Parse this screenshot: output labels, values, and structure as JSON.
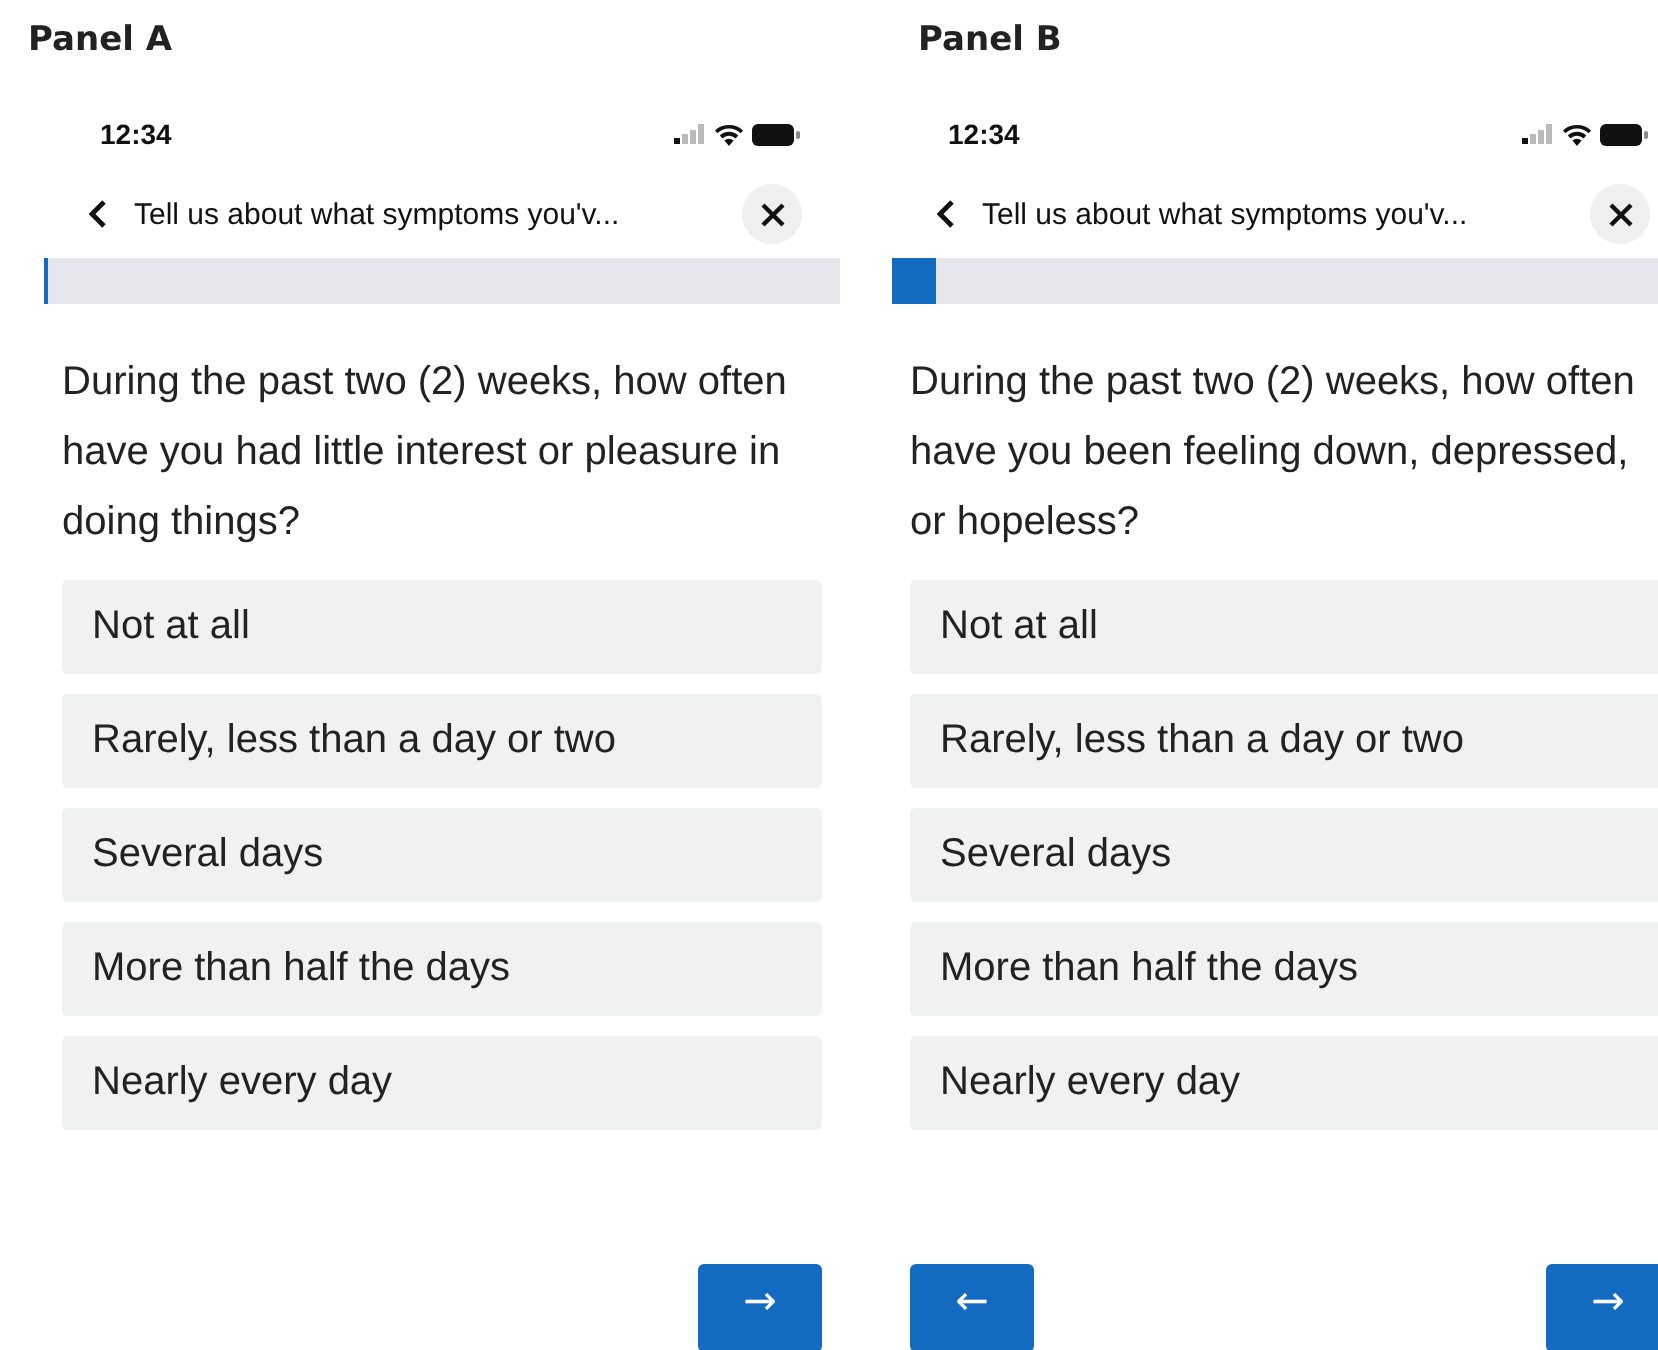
{
  "panels": [
    {
      "label": "Panel A",
      "status_bar": {
        "time": "12:34"
      },
      "header": {
        "title": "Tell us about what symptoms you'v..."
      },
      "progress": {
        "level": 0.005
      },
      "question": "During the past two (2) weeks, how often have you had little interest or pleasure in doing things?",
      "options": [
        {
          "label": "Not at all",
          "selected": false
        },
        {
          "label": "Rarely, less than a day or two",
          "selected": false
        },
        {
          "label": "Several days",
          "selected": false
        },
        {
          "label": "More than half the days",
          "selected": false
        },
        {
          "label": "Nearly every day",
          "selected": false
        }
      ],
      "buttons": [
        {
          "kind": "next",
          "label": "→"
        }
      ]
    },
    {
      "label": "Panel B",
      "status_bar": {
        "time": "12:34"
      },
      "header": {
        "title": "Tell us about what symptoms you'v..."
      },
      "progress": {
        "level": 0.055
      },
      "question": "During the past two (2) weeks, how often have you been feeling down, depressed, or hopeless?",
      "options": [
        {
          "label": "Not at all",
          "selected": false
        },
        {
          "label": "Rarely, less than a day or two",
          "selected": false
        },
        {
          "label": "Several days",
          "selected": false
        },
        {
          "label": "More than half the days",
          "selected": false
        },
        {
          "label": "Nearly every day",
          "selected": false
        }
      ],
      "buttons": [
        {
          "kind": "back",
          "label": "←"
        },
        {
          "kind": "next",
          "label": "→"
        }
      ]
    }
  ]
}
